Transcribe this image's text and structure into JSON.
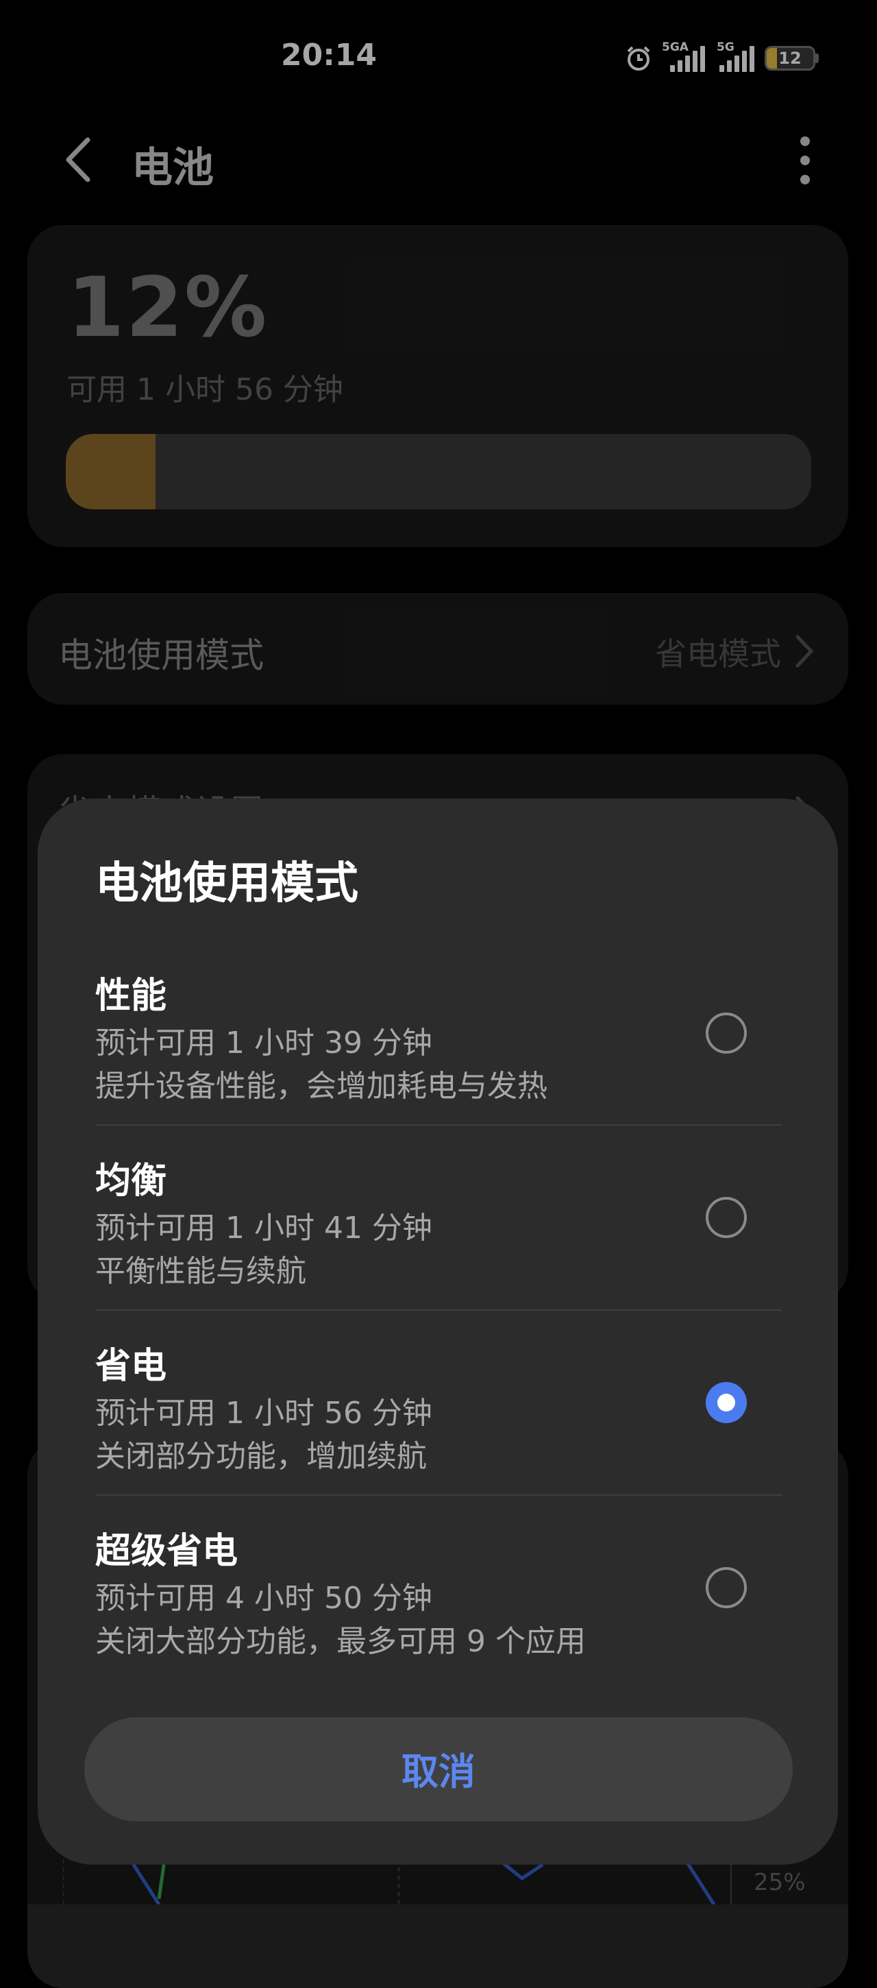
{
  "status_bar": {
    "time": "20:14",
    "network_1": "5GA",
    "network_2": "5G",
    "battery_level": "12",
    "icons": [
      "alarm-icon",
      "signal-icon",
      "signal-icon",
      "battery-icon"
    ]
  },
  "header": {
    "title": "电池"
  },
  "battery": {
    "percent": "12%",
    "remaining": "可用 1 小时 56 分钟",
    "level_fraction": 0.12,
    "fill_color": "#8e6a2c"
  },
  "mode_row": {
    "label": "电池使用模式",
    "value": "省电模式"
  },
  "settings_row": {
    "label": "省电模式设置"
  },
  "chart_peek": {
    "tick_label": "25%"
  },
  "dialog": {
    "title": "电池使用模式",
    "options": [
      {
        "name": "性能",
        "estimate": "预计可用 1 小时 39 分钟",
        "desc": "提升设备性能，会增加耗电与发热",
        "selected": false
      },
      {
        "name": "均衡",
        "estimate": "预计可用 1 小时 41 分钟",
        "desc": "平衡性能与续航",
        "selected": false
      },
      {
        "name": "省电",
        "estimate": "预计可用 1 小时 56 分钟",
        "desc": "关闭部分功能，增加续航",
        "selected": true
      },
      {
        "name": "超级省电",
        "estimate": "预计可用 4 小时 50 分钟",
        "desc": "关闭大部分功能，最多可用 9 个应用",
        "selected": false
      }
    ],
    "cancel_label": "取消",
    "accent_color": "#4b7bef"
  }
}
